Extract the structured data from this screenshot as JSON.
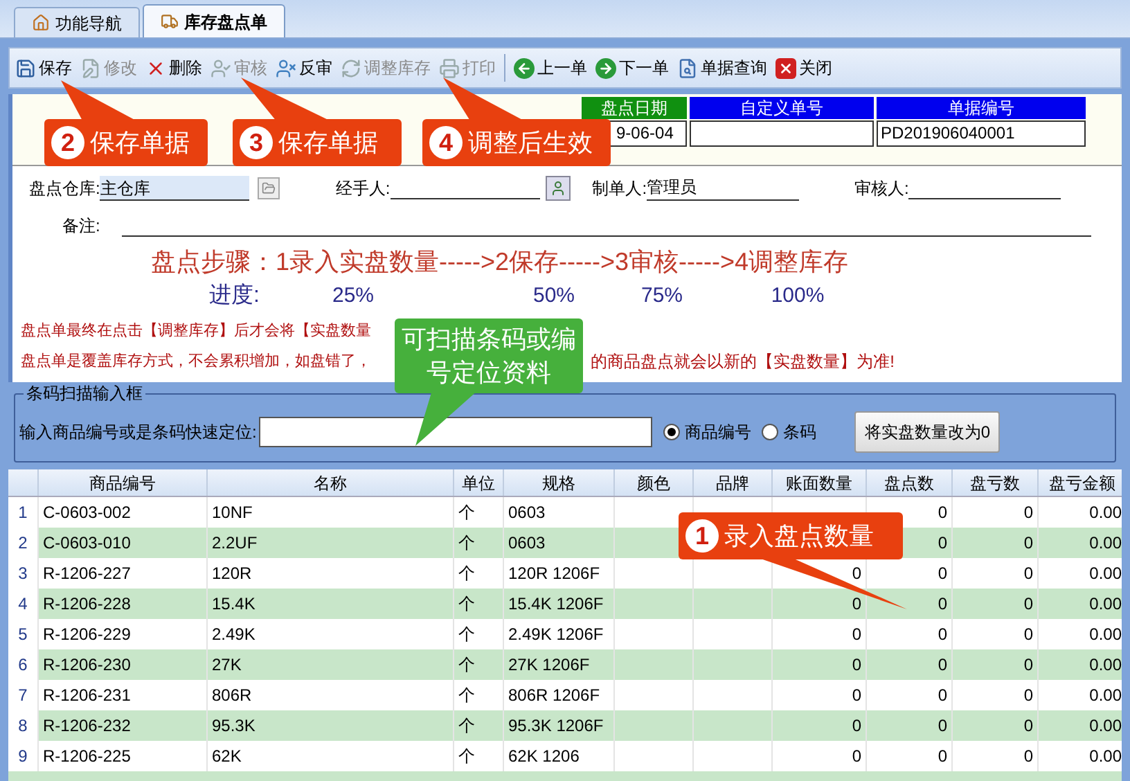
{
  "tabs": [
    {
      "label": "功能导航",
      "selected": false
    },
    {
      "label": "库存盘点单",
      "selected": true
    }
  ],
  "toolbar": [
    {
      "label": "保存",
      "disabled": false
    },
    {
      "label": "修改",
      "disabled": true
    },
    {
      "label": "删除",
      "disabled": false
    },
    {
      "label": "审核",
      "disabled": true
    },
    {
      "label": "反审",
      "disabled": false
    },
    {
      "label": "调整库存",
      "disabled": true
    },
    {
      "label": "打印",
      "disabled": true
    },
    {
      "label": "上一单",
      "disabled": false
    },
    {
      "label": "下一单",
      "disabled": false
    },
    {
      "label": "单据查询",
      "disabled": false
    },
    {
      "label": "关闭",
      "disabled": false
    }
  ],
  "header_fields": [
    {
      "label": "盘点日期",
      "value": "9-06-04",
      "color": "#109010"
    },
    {
      "label": "自定义单号",
      "color": "#0000ee"
    },
    {
      "label": "单据编号",
      "value": "PD201906040001",
      "color": "#0000ee"
    }
  ],
  "form": {
    "warehouse_label": "盘点仓库:",
    "warehouse": "主仓库",
    "handler_label": "经手人:",
    "creator_label": "制单人:",
    "creator": "管理员",
    "reviewer_label": "审核人:",
    "note_label": "备注:"
  },
  "steps": "盘点步骤：1录入实盘数量----->2保存----->3审核----->4调整库存",
  "progress": {
    "label": "进度:",
    "marks": [
      "25%",
      "50%",
      "75%",
      "100%"
    ]
  },
  "notices": [
    {
      "left": "盘点单最终在点击【调整库存】后才会将【实盘数量"
    },
    {
      "left": "盘点单是覆盖库存方式，不会累积增加，如盘错了，",
      "right": "的商品盘点就会以新的【实盘数量】为准!"
    }
  ],
  "barcode": {
    "title": "条码扫描输入框",
    "label": "输入商品编号或是条码快速定位:",
    "options": [
      {
        "label": "商品编号",
        "selected": true
      },
      {
        "label": "条码",
        "selected": false
      }
    ],
    "button": "将实盘数量改为0"
  },
  "table": {
    "columns": [
      "",
      "商品编号",
      "名称",
      "单位",
      "规格",
      "颜色",
      "品牌",
      "账面数量",
      "盘点数",
      "盘亏数",
      "盘亏金额"
    ],
    "rows": [
      [
        "1",
        "C-0603-002",
        "10NF",
        "个",
        "0603",
        "",
        "",
        "",
        "0",
        "0",
        "0.00"
      ],
      [
        "2",
        "C-0603-010",
        "2.2UF",
        "个",
        "0603",
        "",
        "",
        "",
        "0",
        "0",
        "0.00"
      ],
      [
        "3",
        "R-1206-227",
        "120R",
        "个",
        "120R  1206F",
        "",
        "",
        "0",
        "0",
        "0",
        "0.00"
      ],
      [
        "4",
        "R-1206-228",
        "15.4K",
        "个",
        "15.4K 1206F",
        "",
        "",
        "0",
        "0",
        "0",
        "0.00"
      ],
      [
        "5",
        "R-1206-229",
        "2.49K",
        "个",
        "2.49K 1206F",
        "",
        "",
        "0",
        "0",
        "0",
        "0.00"
      ],
      [
        "6",
        "R-1206-230",
        "27K",
        "个",
        "27K 1206F",
        "",
        "",
        "0",
        "0",
        "0",
        "0.00"
      ],
      [
        "7",
        "R-1206-231",
        "806R",
        "个",
        "806R  1206F",
        "",
        "",
        "0",
        "0",
        "0",
        "0.00"
      ],
      [
        "8",
        "R-1206-232",
        "95.3K",
        "个",
        "95.3K 1206F",
        "",
        "",
        "0",
        "0",
        "0",
        "0.00"
      ],
      [
        "9",
        "R-1206-225",
        "62K",
        "个",
        "62K 1206",
        "",
        "",
        "0",
        "0",
        "0",
        "0.00"
      ]
    ]
  },
  "callouts": [
    {
      "number": "2",
      "text": "保存单据",
      "color": "#e8400f"
    },
    {
      "number": "3",
      "text": "保存单据",
      "color": "#e8400f"
    },
    {
      "number": "4",
      "text": "调整后生效",
      "color": "#e8400f"
    },
    {
      "text": "可扫描条码或编号定位资料",
      "color": "#46b03c"
    },
    {
      "number": "1",
      "text": "录入盘点数量",
      "color": "#e8400f"
    }
  ]
}
